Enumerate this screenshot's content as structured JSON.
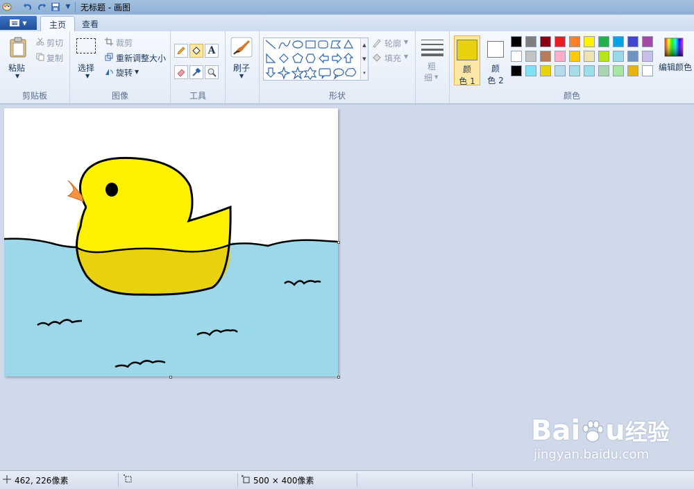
{
  "window": {
    "title": "无标题 - 画图"
  },
  "tabs": [
    {
      "label": "主页"
    },
    {
      "label": "查看"
    }
  ],
  "clipboard": {
    "paste_label": "粘贴",
    "cut_label": "剪切",
    "copy_label": "复制",
    "group_label": "剪贴板"
  },
  "image": {
    "select_label": "选择",
    "crop_label": "裁剪",
    "resize_label": "重新调整大小",
    "rotate_label": "旋转",
    "group_label": "图像"
  },
  "tools": {
    "group_label": "工具",
    "text_tool_glyph": "A"
  },
  "brushes": {
    "label": "刷子"
  },
  "shapes": {
    "outline_label": "轮廓",
    "fill_label": "填充",
    "group_label": "形状"
  },
  "size": {
    "label_1": "粗",
    "label_2": "细"
  },
  "colors": {
    "color1_label_1": "颜",
    "color1_label_2": "色 1",
    "color2_label_1": "颜",
    "color2_label_2": "色 2",
    "edit_label": "编辑颜色",
    "group_label": "颜色",
    "color1_value": "#e8d20f",
    "color2_value": "#ffffff",
    "palette_row1": [
      "#000000",
      "#7f7f7f",
      "#880015",
      "#ed1c24",
      "#ff7f27",
      "#fff200",
      "#22b14c",
      "#00a2e8",
      "#3f48cc",
      "#a349a4"
    ],
    "palette_row2": [
      "#ffffff",
      "#c3c3c3",
      "#b97a57",
      "#ffaec9",
      "#ffc90e",
      "#efe4b0",
      "#b5e61d",
      "#99d9ea",
      "#7092be",
      "#c8bfe7"
    ],
    "palette_row3": [
      "#000000",
      "#7fe1f5",
      "#e8d20f",
      "#b5dbea",
      "#a5dce6",
      "#9adfe9",
      "#a7d6b0",
      "#a5e6a0",
      "#e8b30f",
      "#ffffff"
    ]
  },
  "status": {
    "cursor_position": "462, 226像素",
    "canvas_size": "500 × 400像素"
  },
  "watermark": {
    "brand": "Bai",
    "brand_tail": "u",
    "brand_cn": "经验",
    "url": "jingyan.baidu.com"
  }
}
